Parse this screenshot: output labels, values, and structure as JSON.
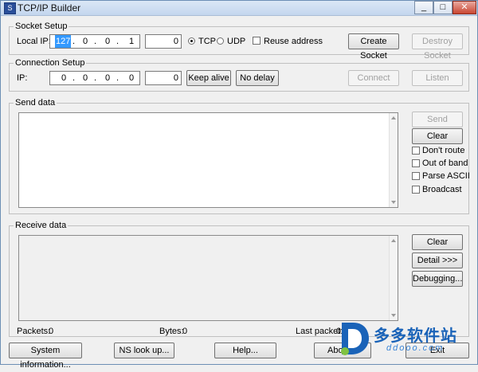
{
  "window": {
    "title": "TCP/IP Builder",
    "icon": "app-icon",
    "minimize": "_",
    "maximize": "□",
    "close": "✕"
  },
  "socket_setup": {
    "legend": "Socket Setup",
    "local_ip_label": "Local IP:",
    "ip_octets": [
      "127",
      "0",
      "0",
      "1"
    ],
    "port": "0",
    "tcp_label": "TCP",
    "udp_label": "UDP",
    "protocol_selected": "TCP",
    "reuse_address_label": "Reuse address",
    "reuse_address_checked": false,
    "create_socket": "Create Socket",
    "destroy_socket": "Destroy Socket"
  },
  "connection_setup": {
    "legend": "Connection Setup",
    "ip_label": "IP:",
    "ip_octets": [
      "0",
      "0",
      "0",
      "0"
    ],
    "port": "0",
    "keep_alive": "Keep alive",
    "no_delay": "No delay",
    "connect": "Connect",
    "listen": "Listen"
  },
  "send_data": {
    "legend": "Send data",
    "send": "Send",
    "clear": "Clear",
    "options": [
      {
        "label": "Don't route",
        "checked": false
      },
      {
        "label": "Out of band",
        "checked": false
      },
      {
        "label": "Parse ASCII",
        "checked": false
      },
      {
        "label": "Broadcast",
        "checked": false
      }
    ]
  },
  "receive_data": {
    "legend": "Receive data",
    "clear": "Clear",
    "detail": "Detail >>>",
    "debugging": "Debugging..."
  },
  "stats": {
    "packets_label": "Packets:",
    "packets_value": "0",
    "bytes_label": "Bytes:",
    "bytes_value": "0",
    "last_packet_label": "Last packet:",
    "last_packet_value": "0"
  },
  "bottom_buttons": {
    "system_information": "System information...",
    "ns_lookup": "NS look up...",
    "help": "Help...",
    "about": "About...",
    "exit": "Exit"
  },
  "watermark": {
    "text": "多多软件站",
    "url": "ddooo.com",
    "color": "#1a63b8"
  }
}
